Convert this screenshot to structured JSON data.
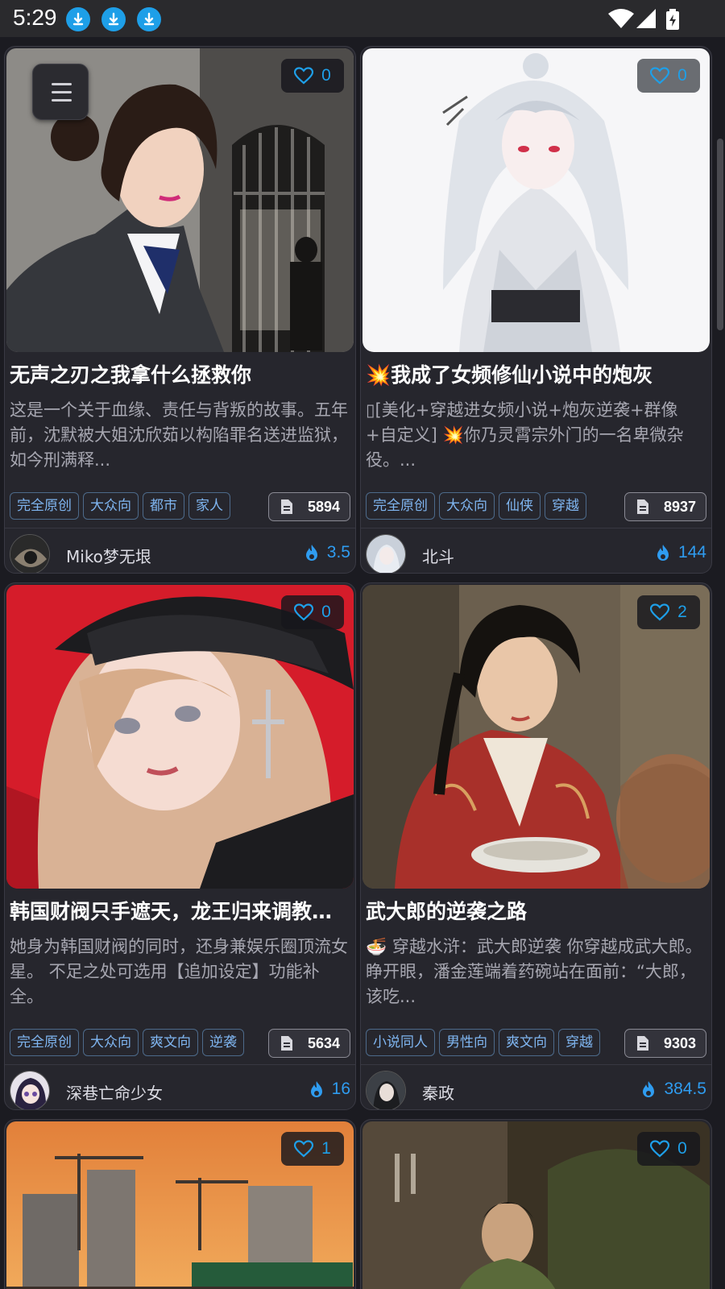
{
  "status_bar": {
    "time": "5:29",
    "icons": [
      "download-icon",
      "download-icon",
      "download-icon",
      "wifi-icon",
      "signal-icon",
      "battery-charging-icon"
    ]
  },
  "colors": {
    "accent": "#1e9fe8",
    "background": "#1b1b21",
    "card": "#26262d",
    "tag_border": "#4d6a8a"
  },
  "cards": [
    {
      "likes": "0",
      "title": "无声之刃之我拿什么拯救你",
      "description": "这是一个关于血缘、责任与背叛的故事。五年前，沈默被大姐沈欣茹以构陷罪名送进监狱，如今刑满释...",
      "tags": [
        "完全原创",
        "大众向",
        "都市",
        "家人"
      ],
      "word_count": "5894",
      "author": "Miko梦无垠",
      "heat": "3.5"
    },
    {
      "likes": "0",
      "title": "💥我成了女频修仙小说中的炮灰",
      "description": "▯[美化+穿越进女频小说+炮灰逆袭+群像+自定义] 💥你乃灵霄宗外门的一名卑微杂役。...",
      "tags": [
        "完全原创",
        "大众向",
        "仙侠",
        "穿越"
      ],
      "word_count": "8937",
      "author": "北斗",
      "heat": "144"
    },
    {
      "likes": "0",
      "title": "韩国财阀只手遮天，龙王归来调教…",
      "description": "她身为韩国财阀的同时，还身兼娱乐圈顶流女星。 不足之处可选用【追加设定】功能补全。",
      "tags": [
        "完全原创",
        "大众向",
        "爽文向",
        "逆袭"
      ],
      "word_count": "5634",
      "author": "深巷亡命少女",
      "heat": "16"
    },
    {
      "likes": "2",
      "title": "武大郎的逆袭之路",
      "description": "🍜 穿越水浒：武大郎逆袭 你穿越成武大郎。睁开眼，潘金莲端着药碗站在面前：“大郎，该吃...",
      "tags": [
        "小说同人",
        "男性向",
        "爽文向",
        "穿越"
      ],
      "word_count": "9303",
      "author": "秦政",
      "heat": "384.5"
    },
    {
      "likes": "1"
    },
    {
      "likes": "0"
    }
  ]
}
